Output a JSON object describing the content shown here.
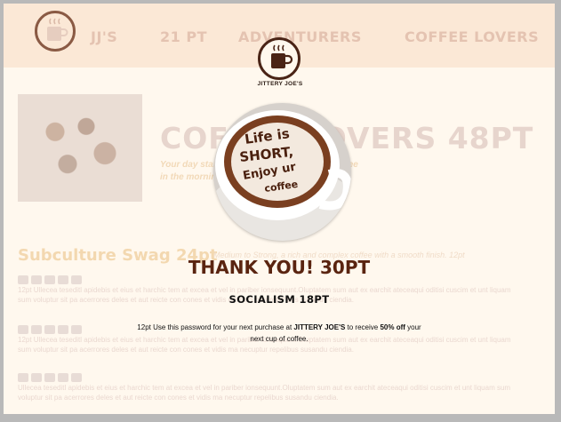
{
  "nav": {
    "items": [
      "JJ'S",
      "21 PT",
      "ADVENTURERS",
      "COFFEE LOVERS"
    ]
  },
  "background": {
    "title": "COFFEE LOVERS 48PT",
    "subtitle_line1": "Your day starts with the first sip of a hot coffee",
    "subtitle_line2": "in the morning",
    "heading": "Subculture Swag 24pt",
    "heading_note": "Medium to Strong, a rich and complex coffee with a smooth finish. 12pt",
    "paragraph1": "12pt Ullecea teseditl apidebis et eius et harchic tem at excea et vel in pariber ionsequunt.Oluptatem sum aut ex earchit ateceaqui oditisi cuscim et unt liquam sum voluptur sit pa acerrores deles et aut reicte con cones et vidis ma necuptur repelibus susandu ciendia.",
    "paragraph2": "12pt Ullecea teseditl apidebis et eius et harchic tem at excea et vel in pariber ionsequunt.Oluptatem sum aut ex earchit ateceaqui oditisi cuscim et unt liquam sum voluptur sit pa acerrores deles et aut reicte con cones et vidis ma necuptur repelibus susandu ciendia.",
    "paragraph3": "Ullecea teseditl apidebis et eius et harchic tem at excea et vel in pariber ionsequunt.Oluptatem sum aut ex earchit ateceaqui oditisi cuscim et unt liquam sum voluptur sit pa acerrores deles et aut reicte con cones et vidis ma necuptur repelibus susandu ciendia."
  },
  "modal": {
    "brand": "JITTERY JOE'S",
    "hero_text_line1": "Life is",
    "hero_text_line2": "SHORT,",
    "hero_text_line3": "Enjoy ur",
    "hero_text_line4": "coffee",
    "title": "THANK YOU! 30PT",
    "subtitle": "SOCIALISM 18PT",
    "message_part1": "12pt Use this password for your next purchase at ",
    "message_brand": "JITTERY JOE'S",
    "message_part2": " to receive ",
    "message_discount": "50% off",
    "message_part3": " your next cup of coffee."
  },
  "colors": {
    "modal_title": "#5a2410",
    "nav_bg": "#fbe8d6",
    "page_bg": "#fff8ee"
  },
  "icons": [
    "coffee-cup-icon"
  ]
}
